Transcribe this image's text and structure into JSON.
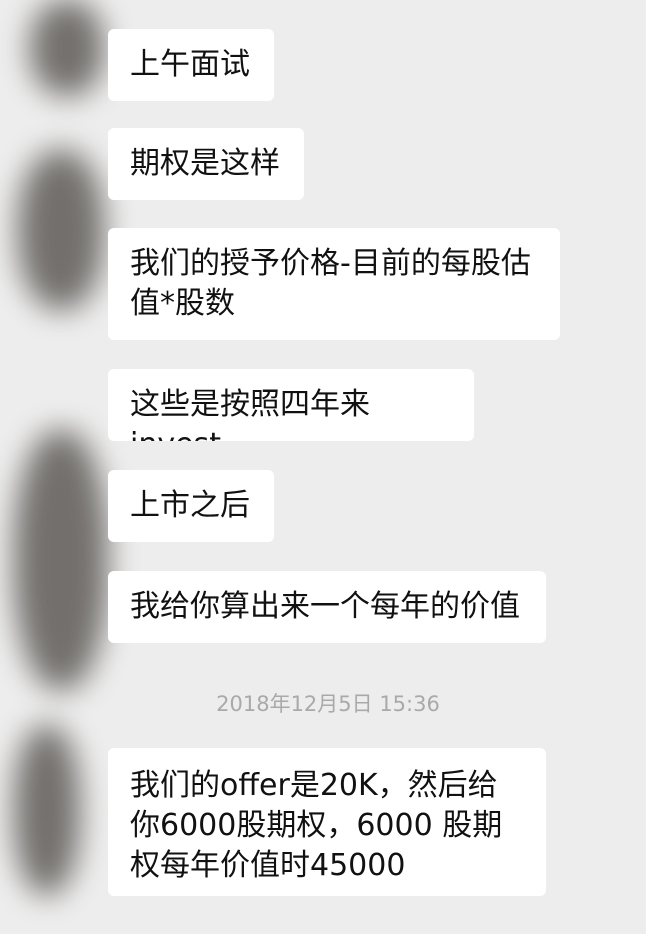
{
  "chat": {
    "messages": [
      {
        "text": "上午面试"
      },
      {
        "text": "期权是这样"
      },
      {
        "text": "我们的授予价格-目前的每股估值*股数"
      },
      {
        "text": "这些是按照四年来invest"
      },
      {
        "text": "上市之后"
      },
      {
        "text": "我给你算出来一个每年的价值"
      }
    ],
    "timestamp": "2018年12月5日 15:36",
    "last_message": {
      "text": "我们的offer是20K，然后给你6000股期权，6000 股期权每年价值时45000"
    }
  },
  "colors": {
    "background": "#ededed",
    "bubble": "#ffffff",
    "text": "#111111",
    "timestamp": "#a9a9a9"
  }
}
